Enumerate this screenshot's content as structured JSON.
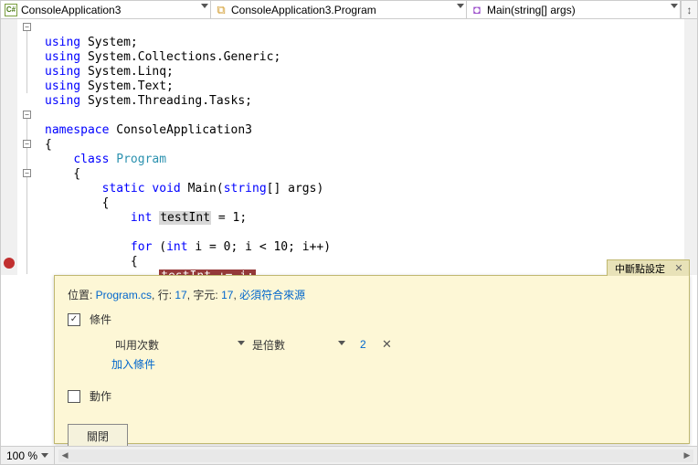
{
  "nav": {
    "project": "ConsoleApplication3",
    "class": "ConsoleApplication3.Program",
    "method": "Main(string[] args)"
  },
  "code": {
    "lines": [
      {
        "t": "using",
        "rest": " System;"
      },
      {
        "t": "using",
        "rest": " System.Collections.Generic;"
      },
      {
        "t": "using",
        "rest": " System.Linq;"
      },
      {
        "t": "using",
        "rest": " System.Text;"
      },
      {
        "t": "using",
        "rest": " System.Threading.Tasks;"
      }
    ],
    "ns": "ConsoleApplication3",
    "cls": "Program",
    "method_kw1": "static",
    "method_kw2": "void",
    "method_name": "Main",
    "method_argtype": "string",
    "method_arg": "[] args",
    "int_kw": "int",
    "var1": "testInt",
    "eq1": " = 1;",
    "for_kw": "for",
    "for_rest": " (",
    "for_intkw": "int",
    "for_body": " i = 0; i < 10; i++)",
    "bp_text": "testInt",
    "bp_rest": " += i;"
  },
  "panel": {
    "title": "中斷點設定",
    "loc_label": "位置: ",
    "loc_file": "Program.cs",
    "loc_sep1": ", ",
    "loc_line_lbl": "行: ",
    "loc_line_v": "17",
    "loc_sep2": ", ",
    "loc_char_lbl": "字元: ",
    "loc_char_v": "17",
    "loc_sep3": ", ",
    "loc_match": "必須符合來源",
    "cond_label": "條件",
    "cond_sel1": "叫用次數",
    "cond_sel2": "是倍數",
    "cond_val": "2",
    "add_cond": "加入條件",
    "action_label": "動作",
    "close_btn": "關閉"
  },
  "bottom": {
    "zoom": "100 %"
  }
}
